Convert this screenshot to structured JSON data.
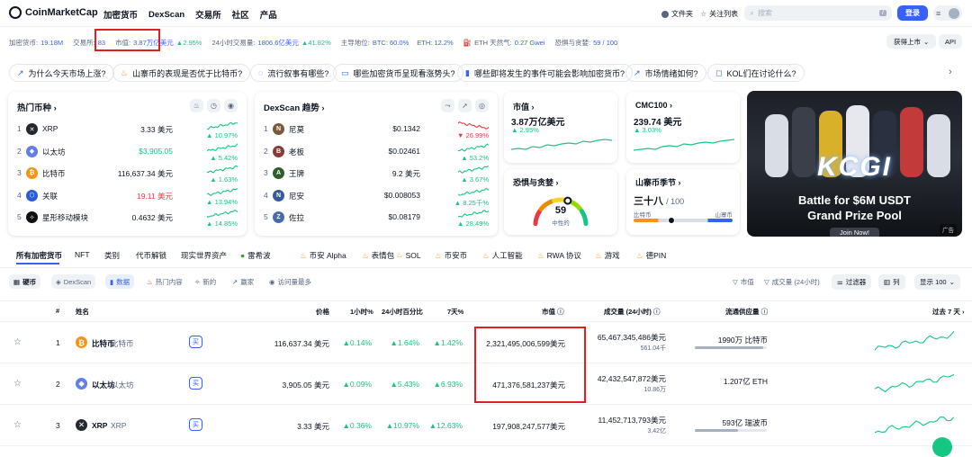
{
  "nav": {
    "logo": "CoinMarketCap",
    "items": [
      "加密货币",
      "DexScan",
      "交易所",
      "社区",
      "产品"
    ],
    "right": {
      "portfolio": "文件夹",
      "watchlist": "关注列表",
      "search_placeholder": "搜索",
      "search_key": "/",
      "login": "登录"
    }
  },
  "ticker": {
    "coins_label": "加密货币:",
    "coins": "19.18M",
    "exchanges_label": "交易所:",
    "exchanges": "83",
    "mcap_label": "市值:",
    "mcap": "3.87万亿美元",
    "mcap_change": "2.95%",
    "vol_label": "24小时交易量:",
    "vol": "1806.6亿美元",
    "vol_change": "41.82%",
    "dom_label": "主导地位:",
    "btc": "BTC: 60.0%",
    "eth": "ETH: 12.2%",
    "gas_label": "ETH 天然气:",
    "gas": "0.27 Gwei",
    "fear_label": "恐惧与贪婪:",
    "fear": "59 / 100",
    "get_listed": "获得上市",
    "api": "API"
  },
  "pills": [
    "为什么今天市场上涨?",
    "山寨币的表现是否优于比特币?",
    "流行叙事有哪些?",
    "哪些加密货币呈现看涨势头?",
    "哪些即将发生的事件可能会影响加密货币?",
    "市场情绪如何?",
    "KOL们在讨论什么?"
  ],
  "trending": {
    "title": "热门币种",
    "rows": [
      {
        "rank": "1",
        "name": "XRP",
        "price": "3.33 美元",
        "change": "10.97%",
        "dir": "up",
        "icon": "xrp-icon",
        "color": "#23292f",
        "glyph": "✕"
      },
      {
        "rank": "2",
        "name": "以太坊",
        "price": "$3,905.05",
        "change": "5.42%",
        "dir": "up",
        "icon": "ethereum-icon",
        "color": "#627eea",
        "glyph": "◆"
      },
      {
        "rank": "3",
        "name": "比特币",
        "price": "116,637.34 美元",
        "change": "1.63%",
        "dir": "up",
        "icon": "bitcoin-icon",
        "color": "#f7931a",
        "glyph": "₿"
      },
      {
        "rank": "4",
        "name": "关联",
        "price": "19.11 美元",
        "change": "13.94%",
        "dir": "up",
        "icon": "chainlink-icon",
        "color": "#2a5ada",
        "glyph": "⬡"
      },
      {
        "rank": "5",
        "name": "星形移动模块",
        "price": "0.4632 美元",
        "change": "14.85%",
        "dir": "up",
        "icon": "stellar-icon",
        "color": "#111",
        "glyph": "✧"
      }
    ]
  },
  "dexscan": {
    "title": "DexScan 趋势",
    "rows": [
      {
        "rank": "1",
        "name": "尼莫",
        "price": "$0.1342",
        "change": "26.99%",
        "dir": "down",
        "icon": "nemo-icon",
        "color": "#7a5a3a",
        "glyph": "N"
      },
      {
        "rank": "2",
        "name": "老板",
        "price": "$0.02461",
        "change": "53.2%",
        "dir": "up",
        "icon": "boss-icon",
        "color": "#8b3a3a",
        "glyph": "B"
      },
      {
        "rank": "3",
        "name": "王牌",
        "price": "9.2 美元",
        "change": "3.67%",
        "dir": "up",
        "icon": "ace-icon",
        "color": "#2e5e2e",
        "glyph": "A"
      },
      {
        "rank": "4",
        "name": "尼安",
        "price": "$0.008053",
        "change": "8.25千%",
        "dir": "up",
        "icon": "nian-icon",
        "color": "#345a9a",
        "glyph": "N"
      },
      {
        "rank": "5",
        "name": "佐拉",
        "price": "$0.08179",
        "change": "28.49%",
        "dir": "up",
        "icon": "zora-icon",
        "color": "#4a6ab0",
        "glyph": "Z"
      }
    ]
  },
  "market_cap_card": {
    "title": "市值",
    "value": "3.87万亿美元",
    "change": "2.95%"
  },
  "cmc100_card": {
    "title": "CMC100",
    "value": "239.74 美元",
    "change": "3.03%"
  },
  "fear_card": {
    "title": "恐惧与贪婪",
    "value": "59",
    "label": "中性的",
    "level": 59
  },
  "altseason_card": {
    "title": "山寨币季节",
    "value": "三十八",
    "max": "/ 100",
    "left": "比特币",
    "right": "山寨币",
    "level": 38
  },
  "banner": {
    "headline": "Battle for $6M USDT",
    "subline": "Grand Prize Pool",
    "button": "Join Now!",
    "tag": "广告",
    "brand": "KCGI"
  },
  "categories": [
    "所有加密货币",
    "NFT",
    "类别",
    "代币解锁",
    "现实世界资产",
    "雷希波",
    "币安 Alpha",
    "表情包",
    "SOL",
    "币安币",
    "人工智能",
    "RWA 协议",
    "游戏",
    "德PIN"
  ],
  "filters": {
    "coins": "硬币",
    "dexscan": "DexScan",
    "ranking": "数据",
    "hot": "热门内容",
    "new": "新的",
    "gainers": "赢家",
    "most_visited": "访问量最多",
    "mcap": "市值",
    "vol": "成交量 (24小时)",
    "filter": "过滤器",
    "columns": "列",
    "show": "显示 100"
  },
  "table": {
    "headers": {
      "rank": "#",
      "name": "姓名",
      "price": "价格",
      "h1": "1小时%",
      "h24": "24小时百分比",
      "d7": "7天%",
      "mcap": "市值",
      "vol": "成交量 (24小时)",
      "supply": "流通供应量",
      "last7": "过去 7 天"
    },
    "buy_label": "买",
    "rows": [
      {
        "rank": "1",
        "name": "比特币",
        "symbol": "比特币",
        "price": "116,637.34 美元",
        "h1": "0.14%",
        "h24": "1.64%",
        "d7": "1.42%",
        "mcap": "2,321,495,006,599美元",
        "vol": "65,467,345,486美元",
        "vol_sub": "561.04千",
        "supply": "1990万 比特币",
        "supply_frac": 0.95,
        "icon": "bitcoin-icon",
        "color": "#f7931a",
        "glyph": "₿"
      },
      {
        "rank": "2",
        "name": "以太坊",
        "symbol": "以太坊",
        "price": "3,905.05 美元",
        "h1": "0.09%",
        "h24": "5.43%",
        "d7": "6.93%",
        "mcap": "471,376,581,237美元",
        "vol": "42,432,547,872美元",
        "vol_sub": "10.86万",
        "supply": "1.207亿 ETH",
        "supply_frac": 0,
        "icon": "ethereum-icon",
        "color": "#627eea",
        "glyph": "◆"
      },
      {
        "rank": "3",
        "name": "XRP",
        "symbol": "XRP",
        "price": "3.33 美元",
        "h1": "0.36%",
        "h24": "10.97%",
        "d7": "12.63%",
        "mcap": "197,908,247,577美元",
        "vol": "11,452,713,793美元",
        "vol_sub": "3.42亿",
        "supply": "593亿 瑞波币",
        "supply_frac": 0.6,
        "icon": "xrp-icon",
        "color": "#23292f",
        "glyph": "✕"
      }
    ]
  }
}
